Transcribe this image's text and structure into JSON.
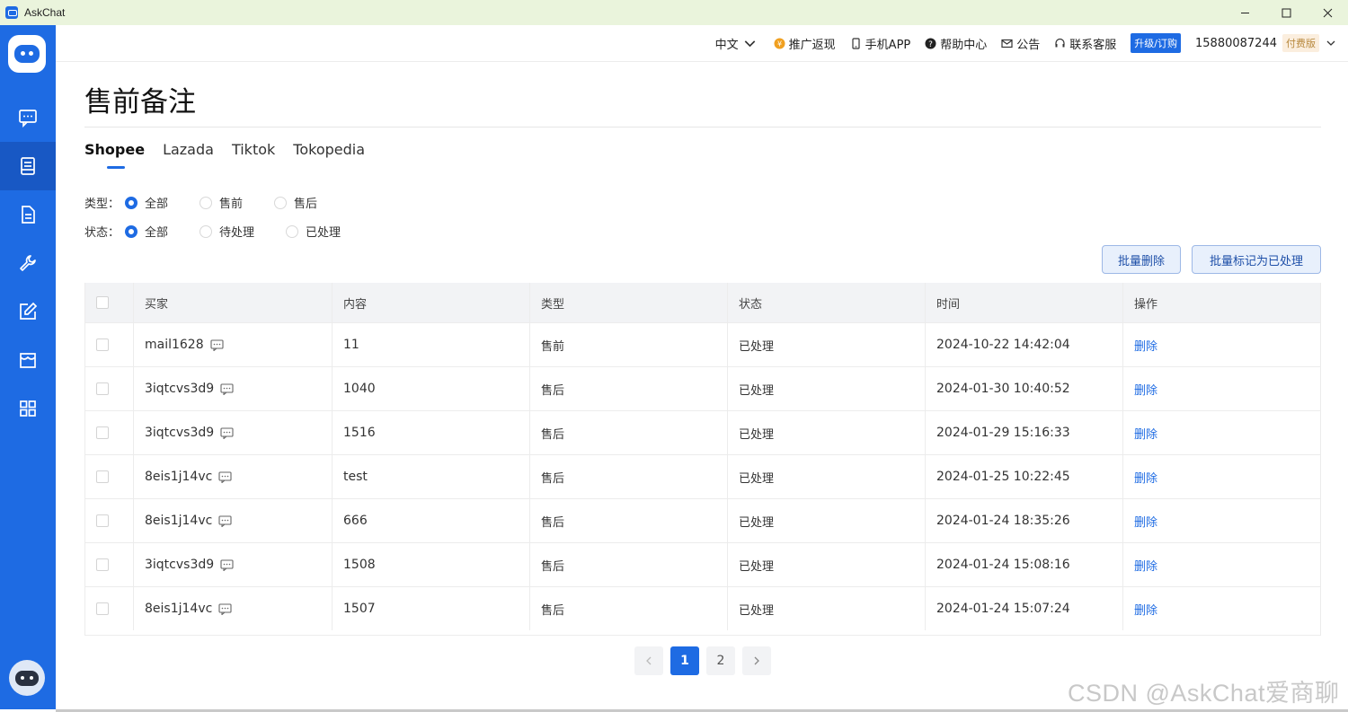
{
  "window": {
    "title": "AskChat"
  },
  "header": {
    "language": "中文",
    "promo": "推广返现",
    "mobile_app": "手机APP",
    "help": "帮助中心",
    "notice": "公告",
    "support": "联系客服",
    "upgrade": "升级/订购",
    "phone": "15880087244",
    "plan_badge": "付费版"
  },
  "page": {
    "title": "售前备注"
  },
  "tabs": [
    {
      "label": "Shopee",
      "active": true
    },
    {
      "label": "Lazada",
      "active": false
    },
    {
      "label": "Tiktok",
      "active": false
    },
    {
      "label": "Tokopedia",
      "active": false
    }
  ],
  "filters": {
    "type": {
      "label": "类型：",
      "options": [
        "全部",
        "售前",
        "售后"
      ],
      "selected": "全部"
    },
    "status": {
      "label": "状态：",
      "options": [
        "全部",
        "待处理",
        "已处理"
      ],
      "selected": "全部"
    }
  },
  "actions": {
    "batch_delete": "批量删除",
    "batch_mark": "批量标记为已处理"
  },
  "table": {
    "headers": [
      "买家",
      "内容",
      "类型",
      "状态",
      "时间",
      "操作"
    ],
    "rows": [
      {
        "buyer": "mail1628",
        "content": "11",
        "type": "售前",
        "status": "已处理",
        "time": "2024-10-22 14:42:04",
        "action": "删除"
      },
      {
        "buyer": "3iqtcvs3d9",
        "content": "1040",
        "type": "售后",
        "status": "已处理",
        "time": "2024-01-30 10:40:52",
        "action": "删除"
      },
      {
        "buyer": "3iqtcvs3d9",
        "content": "1516",
        "type": "售后",
        "status": "已处理",
        "time": "2024-01-29 15:16:33",
        "action": "删除"
      },
      {
        "buyer": "8eis1j14vc",
        "content": "test",
        "type": "售后",
        "status": "已处理",
        "time": "2024-01-25 10:22:45",
        "action": "删除"
      },
      {
        "buyer": "8eis1j14vc",
        "content": "666",
        "type": "售后",
        "status": "已处理",
        "time": "2024-01-24 18:35:26",
        "action": "删除"
      },
      {
        "buyer": "3iqtcvs3d9",
        "content": "1508",
        "type": "售后",
        "status": "已处理",
        "time": "2024-01-24 15:08:16",
        "action": "删除"
      },
      {
        "buyer": "8eis1j14vc",
        "content": "1507",
        "type": "售后",
        "status": "已处理",
        "time": "2024-01-24 15:07:24",
        "action": "删除"
      }
    ]
  },
  "pagination": {
    "pages": [
      "1",
      "2"
    ],
    "current": "1"
  },
  "watermark": "CSDN @AskChat爱商聊",
  "colors": {
    "accent": "#1e6be3",
    "sidebar": "#1e6be3",
    "titlebar": "#eaf4dc"
  }
}
